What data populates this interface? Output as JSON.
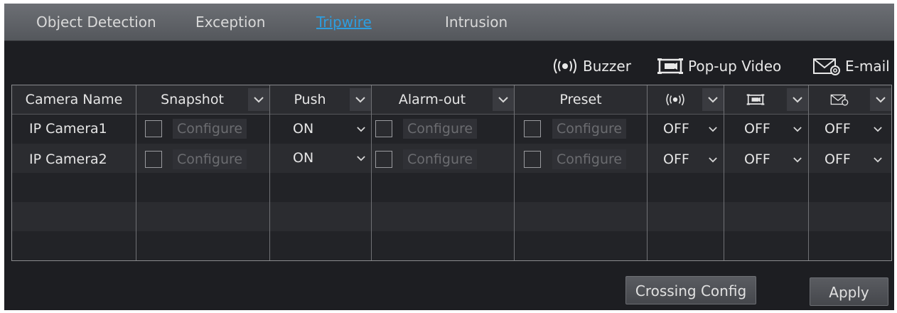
{
  "tabs": [
    {
      "label": "Object Detection",
      "active": false
    },
    {
      "label": "Exception",
      "active": false
    },
    {
      "label": "Tripwire",
      "active": true
    },
    {
      "label": "Intrusion",
      "active": false
    }
  ],
  "legend": {
    "buzzer": "Buzzer",
    "popup_video": "Pop-up Video",
    "email": "E-mail"
  },
  "table": {
    "headers": {
      "camera_name": "Camera Name",
      "snapshot": "Snapshot",
      "push": "Push",
      "alarm_out": "Alarm-out",
      "preset": "Preset"
    },
    "rows": [
      {
        "camera": "IP Camera1",
        "snapshot_cfg": "Configure",
        "push": "ON",
        "alarm_cfg": "Configure",
        "preset_cfg": "Configure",
        "buzzer": "OFF",
        "popup": "OFF",
        "email": "OFF"
      },
      {
        "camera": "IP Camera2",
        "snapshot_cfg": "Configure",
        "push": "ON",
        "alarm_cfg": "Configure",
        "preset_cfg": "Configure",
        "buzzer": "OFF",
        "popup": "OFF",
        "email": "OFF"
      }
    ]
  },
  "buttons": {
    "crossing_config": "Crossing Config",
    "apply": "Apply"
  },
  "colors": {
    "active_tab": "#2d9ee0",
    "background": "#1d1e22",
    "tabbar": "#5f6267"
  }
}
